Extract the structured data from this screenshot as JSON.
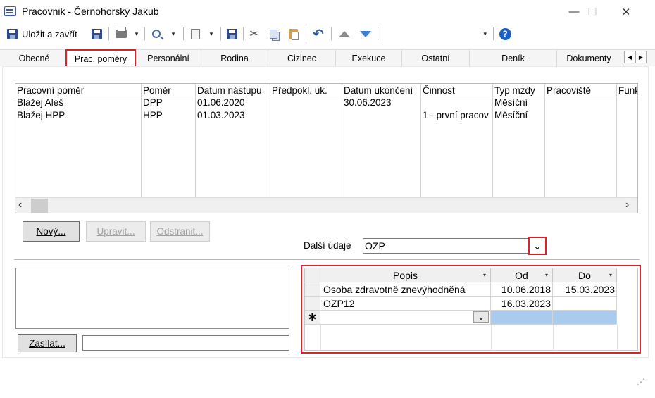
{
  "window": {
    "title": "Pracovnik - Černohorský Jakub",
    "minimize": "—",
    "maximize": "☐",
    "close": "✕"
  },
  "toolbar": {
    "save_close_label": "Uložit a zavřít",
    "dropdown_arrow": "▾",
    "combo_arrow": "▾",
    "help": "?",
    "cut": "✂",
    "undo": "↶"
  },
  "tabs": [
    {
      "label": "Obecné"
    },
    {
      "label": "Prac. poměry"
    },
    {
      "label": "Personální"
    },
    {
      "label": "Rodina"
    },
    {
      "label": "Cizinec"
    },
    {
      "label": "Exekuce"
    },
    {
      "label": "Ostatní"
    },
    {
      "label": "Deník"
    },
    {
      "label": "Dokumenty"
    }
  ],
  "tab_nav": {
    "left": "◀",
    "right": "▶"
  },
  "employment_grid": {
    "columns": [
      "Pracovní poměr",
      "Poměr",
      "Datum nástupu",
      "Předpokl. uk.",
      "Datum ukončení",
      "Činnost",
      "Typ mzdy",
      "Pracoviště",
      "Funk"
    ],
    "rows": [
      [
        "Blažej Aleš",
        "DPP",
        "01.06.2020",
        "",
        "30.06.2023",
        "",
        "Měsíční",
        "",
        ""
      ],
      [
        "Blažej HPP",
        "HPP",
        "01.03.2023",
        "",
        "",
        "1 - první pracov",
        "Měsíční",
        "",
        ""
      ]
    ],
    "scroll_left": "‹",
    "scroll_right": "›"
  },
  "buttons": {
    "new": "Nový...",
    "edit": "Upravit...",
    "remove": "Odstranit...",
    "send": "Zasílat..."
  },
  "additional": {
    "label": "Další údaje",
    "value": "OZP",
    "dropdown_arrow": "⌄"
  },
  "ozp_grid": {
    "columns": [
      "Popis",
      "Od",
      "Do"
    ],
    "sort_arrow": "▾",
    "rows": [
      [
        "Osoba zdravotně znevýhodněná",
        "10.06.2018",
        "15.03.2023"
      ],
      [
        "OZP12",
        "16.03.2023",
        ""
      ]
    ],
    "new_row_marker": "✱",
    "cell_dropdown": "⌄"
  },
  "resize_grip": "⋰",
  "colors": {
    "highlight_red": "#d9232d",
    "selected_cell": "#a8cbee"
  }
}
